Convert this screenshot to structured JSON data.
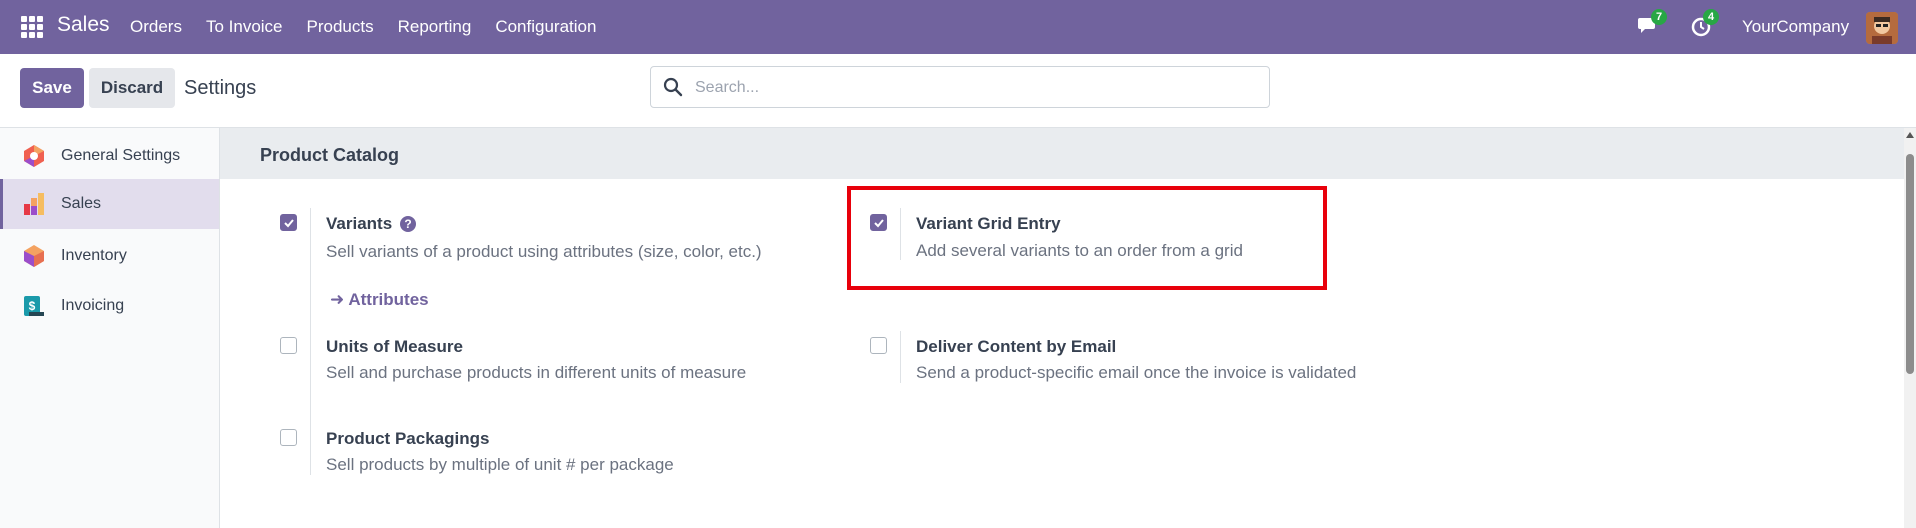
{
  "navbar": {
    "app_name": "Sales",
    "menu": [
      "Orders",
      "To Invoice",
      "Products",
      "Reporting",
      "Configuration"
    ],
    "messages_count": "7",
    "activities_count": "4",
    "company": "YourCompany",
    "bg_color": "#71639e"
  },
  "control": {
    "save_label": "Save",
    "discard_label": "Discard",
    "title": "Settings",
    "search_placeholder": "Search..."
  },
  "sidebar": {
    "items": [
      {
        "label": "General Settings",
        "icon": "odoo-icon",
        "active": false
      },
      {
        "label": "Sales",
        "icon": "sales-icon",
        "active": true
      },
      {
        "label": "Inventory",
        "icon": "inventory-icon",
        "active": false
      },
      {
        "label": "Invoicing",
        "icon": "invoicing-icon",
        "active": false
      }
    ]
  },
  "section": {
    "title": "Product Catalog",
    "settings": [
      {
        "title": "Variants",
        "desc": "Sell variants of a product using attributes (size, color, etc.)",
        "checked": true,
        "help": "?",
        "link": "Attributes"
      },
      {
        "title": "Variant Grid Entry",
        "desc": "Add several variants to an order from a grid",
        "checked": true,
        "highlighted": true
      },
      {
        "title": "Units of Measure",
        "desc": "Sell and purchase products in different units of measure",
        "checked": false
      },
      {
        "title": "Deliver Content by Email",
        "desc": "Send a product-specific email once the invoice is validated",
        "checked": false
      },
      {
        "title": "Product Packagings",
        "desc": "Sell products by multiple of unit # per package",
        "checked": false
      }
    ]
  },
  "colors": {
    "accent": "#71639e",
    "highlight_border": "#e8000b",
    "badge": "#28a745"
  }
}
